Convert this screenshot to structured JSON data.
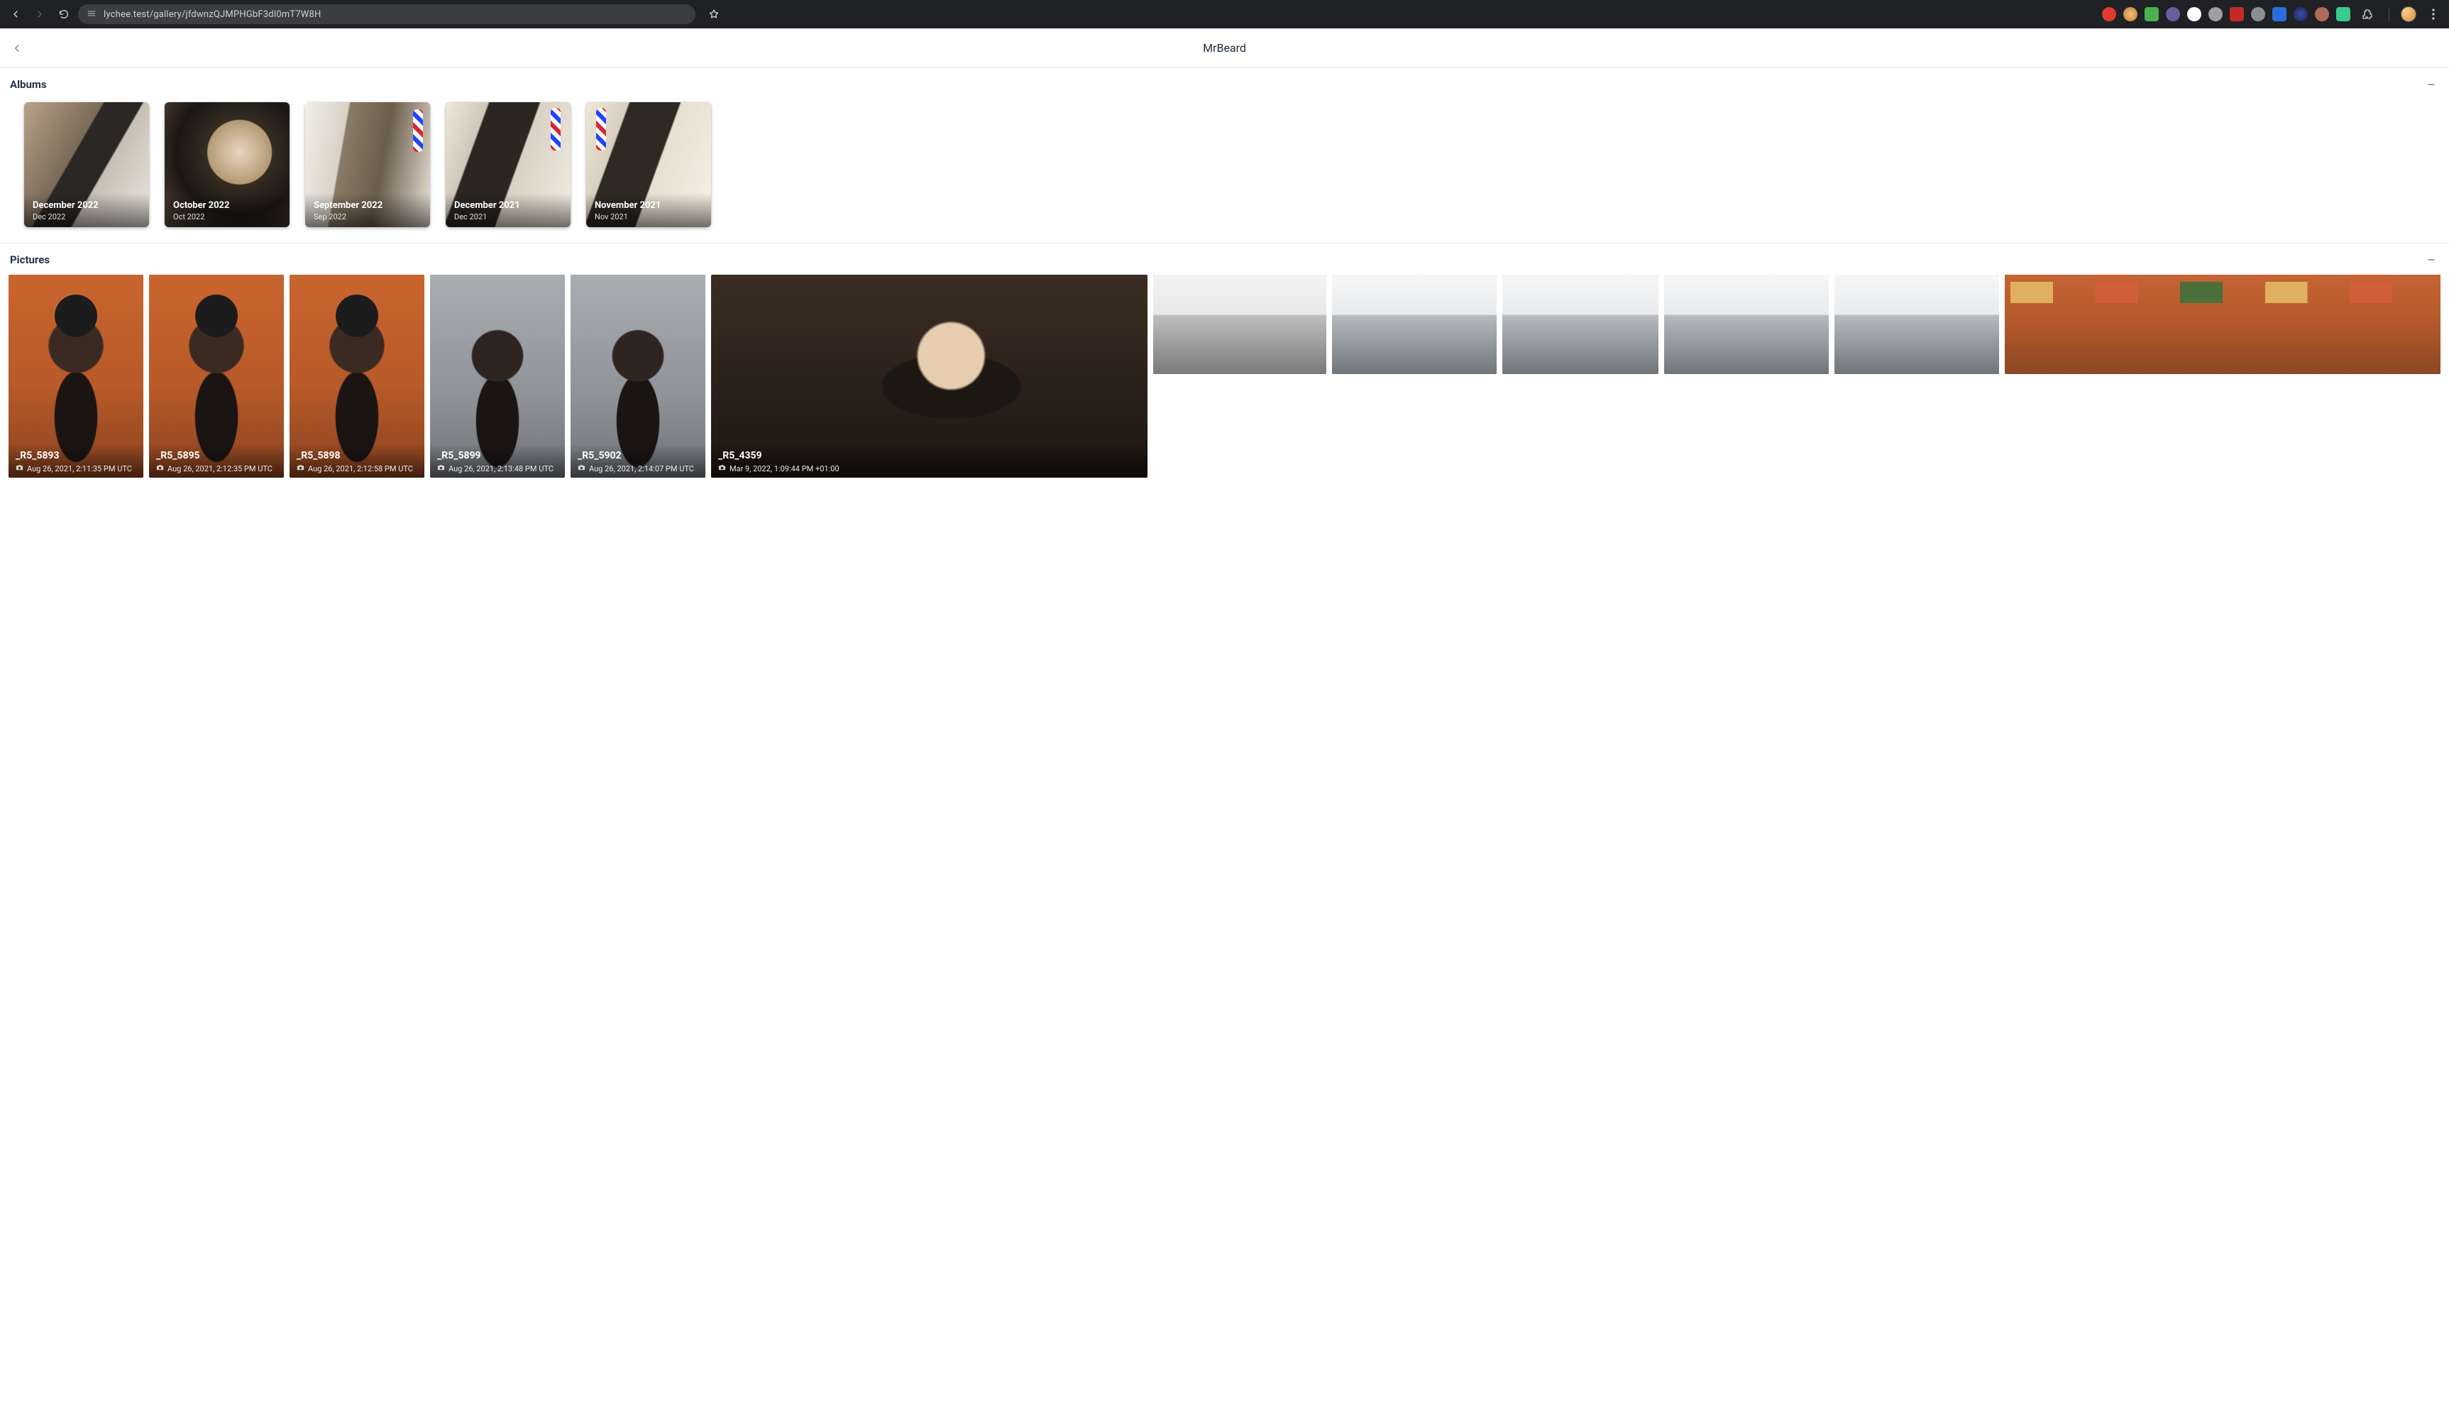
{
  "browser": {
    "url": "lychee.test/gallery/jfdwnzQJMPHGbF3dl0mT7W8H"
  },
  "header": {
    "title": "MrBeard"
  },
  "sections": {
    "albums_label": "Albums",
    "pictures_label": "Pictures"
  },
  "albums": [
    {
      "title": "December 2022",
      "subtitle": "Dec 2022"
    },
    {
      "title": "October 2022",
      "subtitle": "Oct 2022"
    },
    {
      "title": "September 2022",
      "subtitle": "Sep 2022"
    },
    {
      "title": "December 2021",
      "subtitle": "Dec 2021"
    },
    {
      "title": "November 2021",
      "subtitle": "Nov 2021"
    }
  ],
  "photos_row1": [
    {
      "title": "_R5_5893",
      "subtitle": "Aug 26, 2021, 2:11:35 PM UTC"
    },
    {
      "title": "_R5_5895",
      "subtitle": "Aug 26, 2021, 2:12:35 PM UTC"
    },
    {
      "title": "_R5_5898",
      "subtitle": "Aug 26, 2021, 2:12:58 PM UTC"
    },
    {
      "title": "_R5_5899",
      "subtitle": "Aug 26, 2021, 2:13:48 PM UTC"
    },
    {
      "title": "_R5_5902",
      "subtitle": "Aug 26, 2021, 2:14:07 PM UTC"
    },
    {
      "title": "_R5_4359",
      "subtitle": "Mar 9, 2022, 1:09:44 PM +01:00"
    }
  ]
}
